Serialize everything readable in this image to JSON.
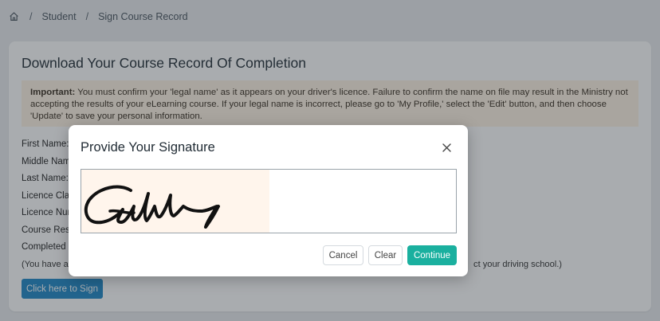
{
  "breadcrumb": {
    "home_icon": "home-icon",
    "items": [
      "Student",
      "Sign Course Record"
    ],
    "separator": "/"
  },
  "card": {
    "title": "Download Your Course Record Of Completion",
    "notice_bold": "Important:",
    "notice_text": " You must confirm your 'legal name' as it appears on your driver's licence. Failure to confirm the name on file may result in the Ministry not accepting the results of your eLearning course. If your legal name is incorrect, please go to 'My Profile,' select the 'Edit' button, and then choose 'Update' to save your personal information.",
    "fields": [
      "First Name:",
      "Middle Nam",
      "Last Name:",
      "Licence Clas",
      "Licence Num",
      "Course Resu",
      "Completed D"
    ],
    "note_left": "(You have al",
    "note_right": "ct your driving school.)",
    "sign_button": "Click here to Sign"
  },
  "modal": {
    "title": "Provide Your Signature",
    "close_icon": "close-icon",
    "cancel_label": "Cancel",
    "clear_label": "Clear",
    "continue_label": "Continue"
  },
  "colors": {
    "primary": "#1e88c7",
    "continue": "#1ab09f",
    "notice_bg": "#fff4e5",
    "signature_bg": "#fff5ec"
  }
}
